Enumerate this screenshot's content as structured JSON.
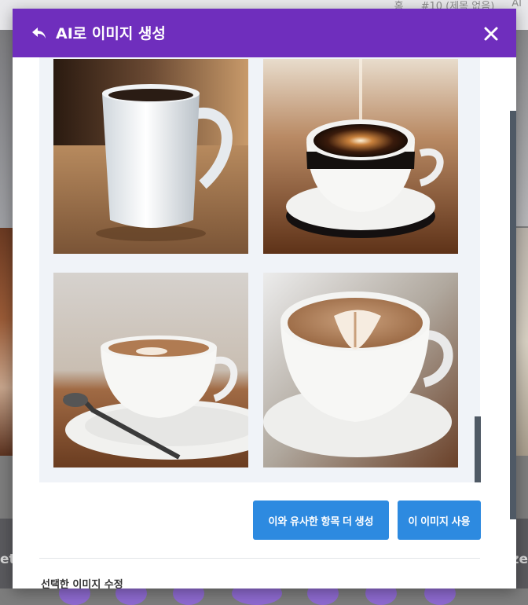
{
  "background": {
    "crumbs": [
      "홈",
      "#10 (제목 없음)",
      "AI"
    ],
    "left_text": "etz",
    "right_text": "ze"
  },
  "modal": {
    "title": "AI로 이미지 생성",
    "back_icon": "undo-arrow-icon",
    "close_icon": "close-icon",
    "images": [
      {
        "name": "white mug with coffee"
      },
      {
        "name": "cup with steam on saucer"
      },
      {
        "name": "latte with spoon"
      },
      {
        "name": "latte art cup"
      }
    ],
    "buttons": {
      "similar_label": "이와 유사한 항목 더 생성",
      "use_label": "이 이미지 사용"
    },
    "section_label": "선택한 이미지 수정"
  },
  "colors": {
    "header": "#6f2ebd",
    "button": "#2d8ae0",
    "gallery_bg": "#f0f3f8"
  }
}
